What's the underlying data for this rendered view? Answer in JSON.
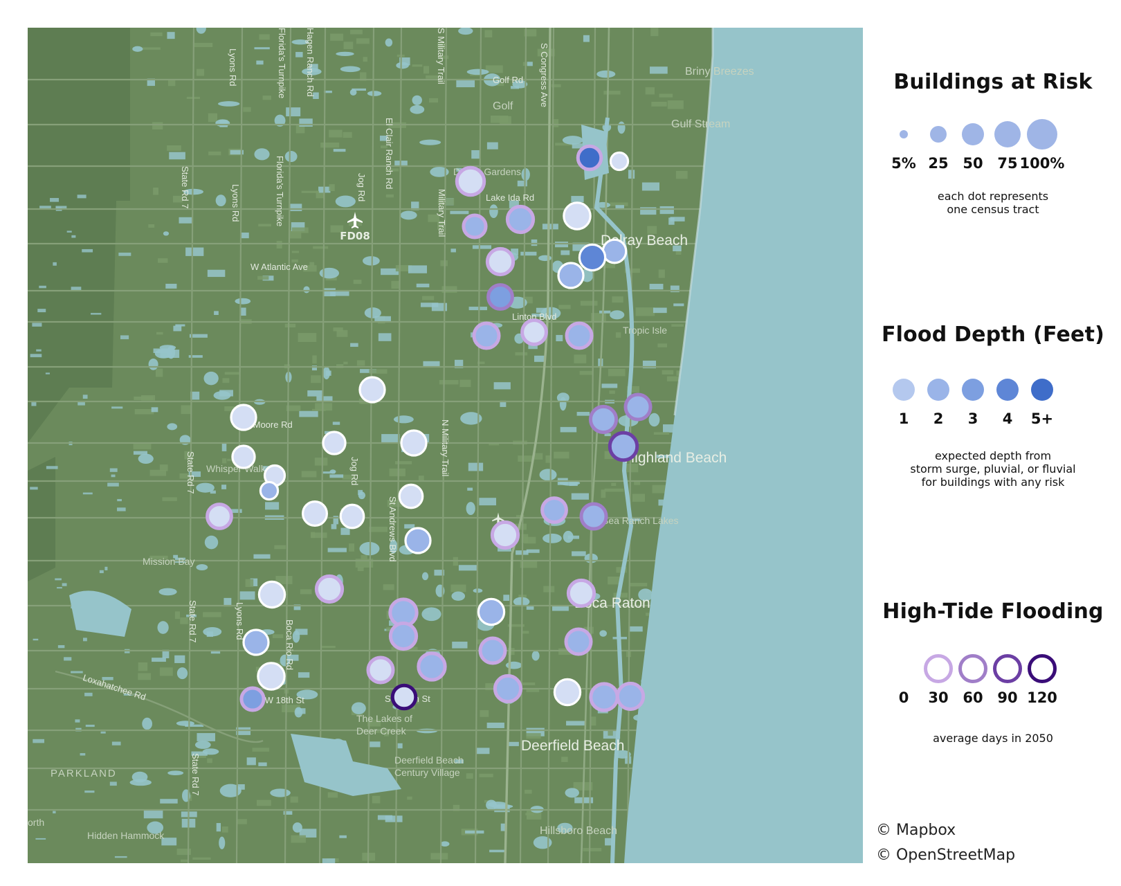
{
  "map": {
    "place_labels": [
      {
        "name": "label-delray-beach",
        "text": "Delray Beach",
        "cls": "town"
      },
      {
        "name": "label-boca-raton",
        "text": "Boca Raton",
        "cls": "town"
      },
      {
        "name": "label-highland-beach",
        "text": "Highland Beach",
        "cls": "town"
      },
      {
        "name": "label-deerfield-beach",
        "text": "Deerfield Beach",
        "cls": "town"
      },
      {
        "name": "label-briny-breezes",
        "text": "Briny Breezes",
        "cls": "place"
      },
      {
        "name": "label-gulf-stream",
        "text": "Gulf Stream",
        "cls": "place"
      },
      {
        "name": "label-delray-gardens",
        "text": "Delray Gardens",
        "cls": "small"
      },
      {
        "name": "label-tropic-isle",
        "text": "Tropic Isle",
        "cls": "small"
      },
      {
        "name": "label-golf",
        "text": "Golf",
        "cls": "place"
      },
      {
        "name": "label-sea-ranch-lakes",
        "text": "Sea Ranch Lakes",
        "cls": "small"
      },
      {
        "name": "label-mission-bay",
        "text": "Mission Bay",
        "cls": "small"
      },
      {
        "name": "label-lakes-deer-creek",
        "text": "The Lakes of\nDeer Creek",
        "cls": "small"
      },
      {
        "name": "label-deerfield-century",
        "text": "Deerfield Beach\nCentury Village",
        "cls": "small"
      },
      {
        "name": "label-parkland",
        "text": "PARKLAND",
        "cls": "caps"
      },
      {
        "name": "label-hillsboro-beach",
        "text": "Hillsboro Beach",
        "cls": "place"
      },
      {
        "name": "label-hidden-hammock",
        "text": "Hidden Hammock",
        "cls": "small"
      },
      {
        "name": "label-north",
        "text": "orth",
        "cls": "small"
      },
      {
        "name": "label-whisper-walk",
        "text": "Whisper Walk",
        "cls": "small"
      }
    ],
    "road_labels": [
      {
        "name": "road-golf-rd",
        "text": "Golf Rd"
      },
      {
        "name": "road-lake-ida-rd",
        "text": "Lake Ida Rd"
      },
      {
        "name": "road-w-atlantic-ave",
        "text": "W Atlantic Ave"
      },
      {
        "name": "road-linton-blvd",
        "text": "Linton Blvd"
      },
      {
        "name": "road-clint-moore-rd",
        "text": "Clint Moore Rd"
      },
      {
        "name": "road-sw-18th-st",
        "text": "SW 18th St"
      },
      {
        "name": "road-sw-10th-st",
        "text": "SW 10th St"
      },
      {
        "name": "road-loxahatchee-rd",
        "text": "Loxahatchee Rd"
      },
      {
        "name": "road-state-rd-7-a",
        "text": "State Rd 7"
      },
      {
        "name": "road-state-rd-7-b",
        "text": "State Rd 7"
      },
      {
        "name": "road-state-rd-7-c",
        "text": "State Rd 7"
      },
      {
        "name": "road-state-rd-7-d",
        "text": "State Rd 7"
      },
      {
        "name": "road-lyons-rd-a",
        "text": "Lyons Rd"
      },
      {
        "name": "road-lyons-rd-b",
        "text": "Lyons Rd"
      },
      {
        "name": "road-floridas-turnpike-a",
        "text": "Florida's Turnpike"
      },
      {
        "name": "road-floridas-turnpike-b",
        "text": "Florida's Turnpike"
      },
      {
        "name": "road-hagen-ranch-rd",
        "text": "Hagen Ranch Rd"
      },
      {
        "name": "road-jog-rd-a",
        "text": "Jog Rd"
      },
      {
        "name": "road-jog-rd-b",
        "text": "Jog Rd"
      },
      {
        "name": "road-el-clair-ranch-rd",
        "text": "El Clair Ranch Rd"
      },
      {
        "name": "road-s-military-trail",
        "text": "S Military Trail"
      },
      {
        "name": "road-military-trail",
        "text": "Military Trail"
      },
      {
        "name": "road-n-military-trail",
        "text": "N Military Trail"
      },
      {
        "name": "road-s-congress-ave",
        "text": "S Congress Ave"
      },
      {
        "name": "road-st-andrews-blvd",
        "text": "St Andrews Blvd"
      },
      {
        "name": "road-boca-rio-rd",
        "text": "Boca Rio Rd"
      },
      {
        "name": "road-lyons-rd-c",
        "text": "Lyons Rd"
      }
    ],
    "airport_label": "FD08",
    "colors": {
      "land": "#6b8a5c",
      "dark_land": "#5e7d52",
      "water": "#96c4ca",
      "road": "#8aa37d"
    }
  },
  "tracts": [
    {
      "buildings": 40,
      "depth": 5,
      "ht": 40
    },
    {
      "buildings": 15,
      "depth": 1,
      "ht": 0
    },
    {
      "buildings": 65,
      "depth": 1,
      "ht": 20
    },
    {
      "buildings": 55,
      "depth": 2,
      "ht": 30
    },
    {
      "buildings": 35,
      "depth": 2,
      "ht": 30
    },
    {
      "buildings": 60,
      "depth": 1,
      "ht": 0
    },
    {
      "buildings": 55,
      "depth": 1,
      "ht": 25
    },
    {
      "buildings": 40,
      "depth": 2,
      "ht": 0
    },
    {
      "buildings": 55,
      "depth": 4,
      "ht": 0
    },
    {
      "buildings": 50,
      "depth": 2,
      "ht": 0
    },
    {
      "buildings": 45,
      "depth": 3,
      "ht": 50
    },
    {
      "buildings": 50,
      "depth": 2,
      "ht": 25
    },
    {
      "buildings": 45,
      "depth": 1,
      "ht": 30
    },
    {
      "buildings": 50,
      "depth": 2,
      "ht": 30
    },
    {
      "buildings": 50,
      "depth": 1,
      "ht": 0
    },
    {
      "buildings": 50,
      "depth": 1,
      "ht": 0
    },
    {
      "buildings": 35,
      "depth": 1,
      "ht": 0
    },
    {
      "buildings": 50,
      "depth": 1,
      "ht": 0
    },
    {
      "buildings": 35,
      "depth": 1,
      "ht": 0
    },
    {
      "buildings": 25,
      "depth": 1,
      "ht": 0
    },
    {
      "buildings": 15,
      "depth": 2,
      "ht": 0
    },
    {
      "buildings": 45,
      "depth": 1,
      "ht": 20
    },
    {
      "buildings": 45,
      "depth": 1,
      "ht": 0
    },
    {
      "buildings": 40,
      "depth": 1,
      "ht": 0
    },
    {
      "buildings": 40,
      "depth": 1,
      "ht": 0
    },
    {
      "buildings": 50,
      "depth": 2,
      "ht": 0
    },
    {
      "buildings": 55,
      "depth": 2,
      "ht": 60
    },
    {
      "buildings": 50,
      "depth": 2,
      "ht": 70
    },
    {
      "buildings": 65,
      "depth": 2,
      "ht": 90
    },
    {
      "buildings": 45,
      "depth": 2,
      "ht": 30
    },
    {
      "buildings": 50,
      "depth": 2,
      "ht": 50
    },
    {
      "buildings": 55,
      "depth": 1,
      "ht": 20
    },
    {
      "buildings": 55,
      "depth": 1,
      "ht": 0
    },
    {
      "buildings": 55,
      "depth": 1,
      "ht": 25
    },
    {
      "buildings": 60,
      "depth": 2,
      "ht": 30
    },
    {
      "buildings": 55,
      "depth": 2,
      "ht": 0
    },
    {
      "buildings": 55,
      "depth": 1,
      "ht": 25
    },
    {
      "buildings": 55,
      "depth": 2,
      "ht": 30
    },
    {
      "buildings": 50,
      "depth": 2,
      "ht": 40
    },
    {
      "buildings": 50,
      "depth": 2,
      "ht": 0
    },
    {
      "buildings": 60,
      "depth": 1,
      "ht": 0
    },
    {
      "buildings": 50,
      "depth": 1,
      "ht": 20
    },
    {
      "buildings": 60,
      "depth": 2,
      "ht": 30
    },
    {
      "buildings": 50,
      "depth": 2,
      "ht": 40
    },
    {
      "buildings": 55,
      "depth": 2,
      "ht": 20
    },
    {
      "buildings": 55,
      "depth": 1,
      "ht": 0
    },
    {
      "buildings": 40,
      "depth": 1,
      "ht": 120
    },
    {
      "buildings": 35,
      "depth": 3,
      "ht": 20
    },
    {
      "buildings": 60,
      "depth": 2,
      "ht": 25
    },
    {
      "buildings": 55,
      "depth": 2,
      "ht": 30
    }
  ],
  "legend": {
    "buildings": {
      "title": "Buildings at Risk",
      "items": [
        {
          "label": "5%",
          "value": 5
        },
        {
          "label": "25",
          "value": 25
        },
        {
          "label": "50",
          "value": 50
        },
        {
          "label": "75",
          "value": 75
        },
        {
          "label": "100%",
          "value": 100
        }
      ],
      "note_line1": "each dot represents",
      "note_line2": "one census tract"
    },
    "depth": {
      "title": "Flood Depth (Feet)",
      "items": [
        {
          "label": "1",
          "color": "#b4c8ee"
        },
        {
          "label": "2",
          "color": "#9ab4e8"
        },
        {
          "label": "3",
          "color": "#7d9fe0"
        },
        {
          "label": "4",
          "color": "#5e86d6"
        },
        {
          "label": "5+",
          "color": "#3f6dc9"
        }
      ],
      "note_line1": "expected depth from",
      "note_line2": "storm surge, pluvial, or fluvial",
      "note_line3": "for buildings with any risk"
    },
    "tide": {
      "title": "High-Tide Flooding",
      "items": [
        {
          "label": "0",
          "color": "#ffffff"
        },
        {
          "label": "30",
          "color": "#c7a8e4"
        },
        {
          "label": "60",
          "color": "#a07ec8"
        },
        {
          "label": "90",
          "color": "#6c3fa4"
        },
        {
          "label": "120",
          "color": "#3a0d78"
        }
      ],
      "note": "average days in 2050"
    }
  },
  "credits": {
    "mapbox": "© Mapbox",
    "osm": "© OpenStreetMap"
  }
}
